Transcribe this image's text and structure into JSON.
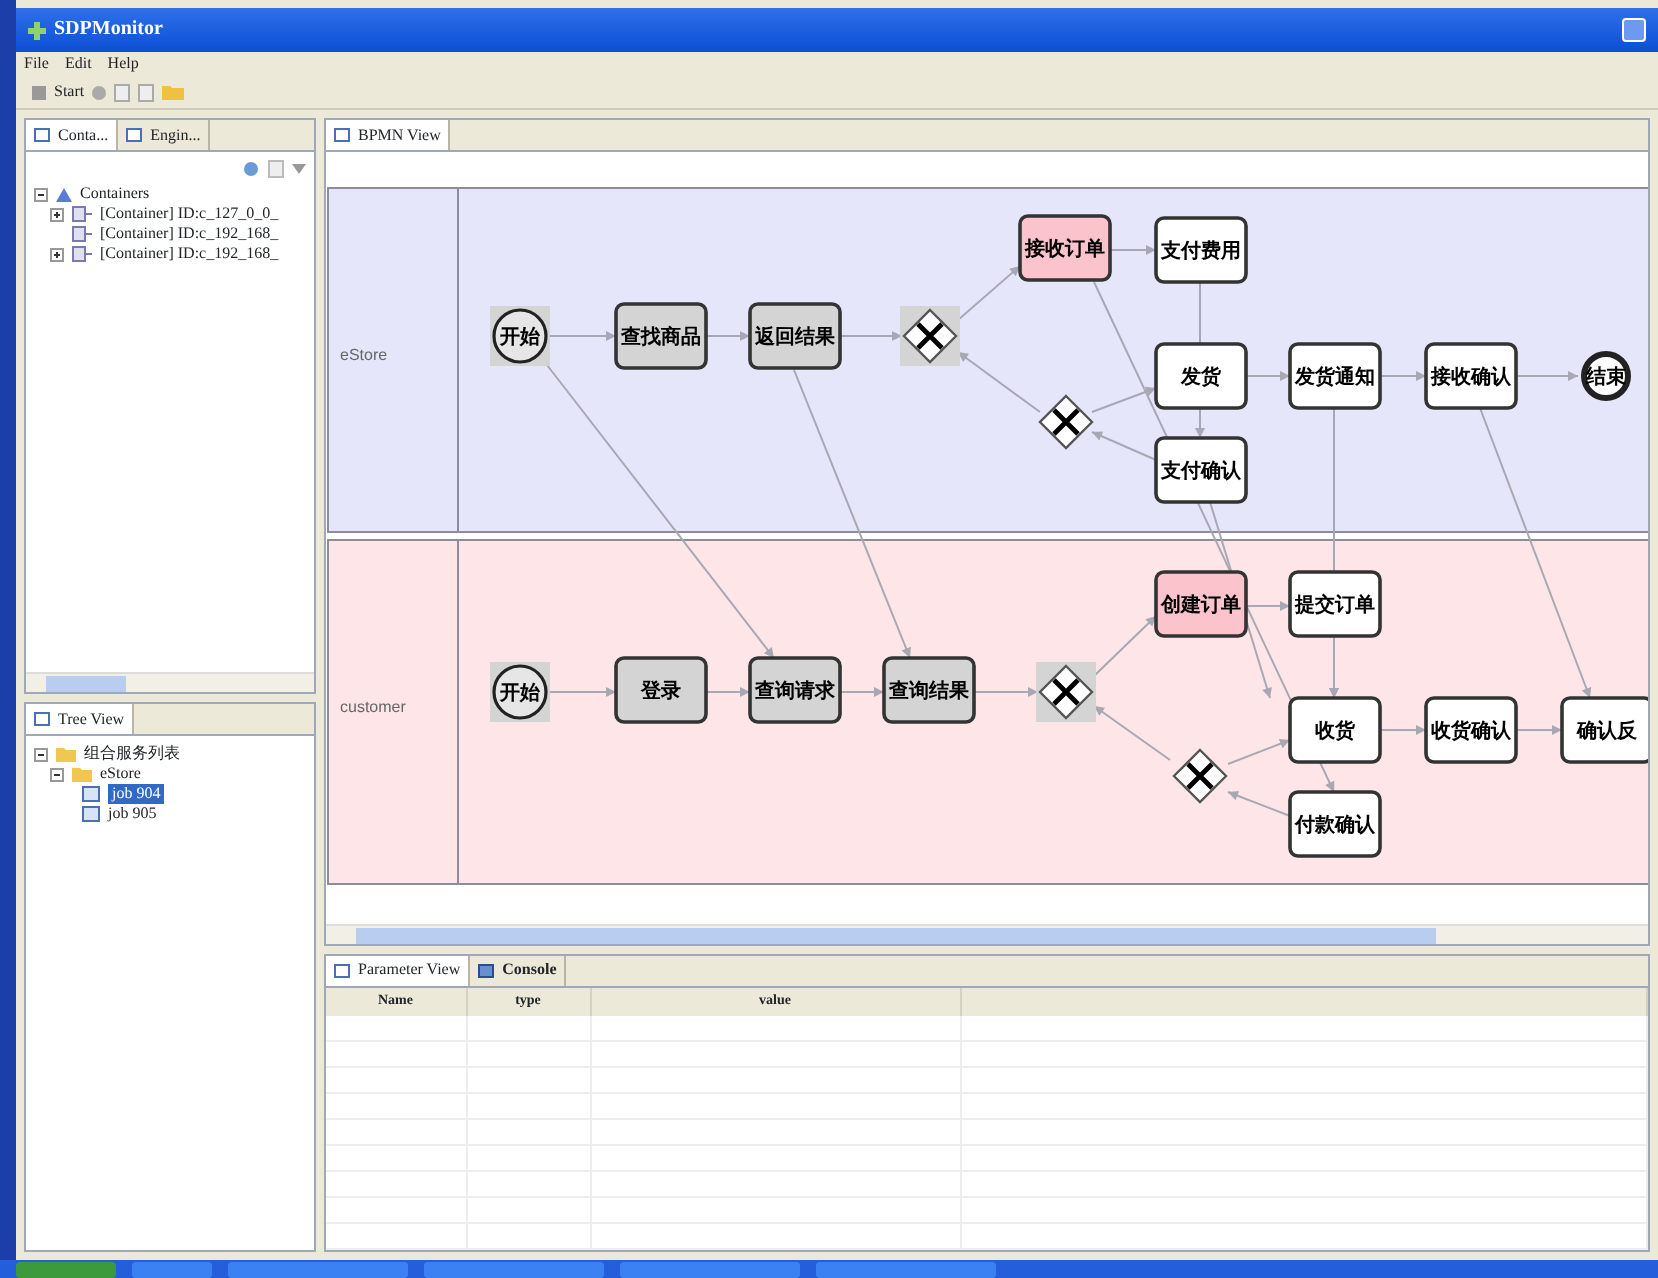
{
  "window": {
    "title": "SDPMonitor"
  },
  "menu": [
    "File",
    "Edit",
    "Help"
  ],
  "toolbar": {
    "start_label": "Start"
  },
  "left_tabs": [
    {
      "label": "Conta...",
      "selected": true
    },
    {
      "label": "Engin...",
      "selected": false
    }
  ],
  "containers_tree": {
    "label": "Containers",
    "expanded": true,
    "children": [
      {
        "label": "[Container] ID:c_127_0_0_",
        "expanded": false
      },
      {
        "label": "[Container] ID:c_192_168_"
      },
      {
        "label": "[Container] ID:c_192_168_",
        "expanded": false
      }
    ]
  },
  "tree_view": {
    "tab": "Tree View",
    "root": {
      "label": "组合服务列表",
      "expanded": true,
      "children": [
        {
          "label": "eStore",
          "expanded": true,
          "children": [
            {
              "label": "job 904",
              "selected": true
            },
            {
              "label": "job 905",
              "selected": false
            }
          ]
        }
      ]
    }
  },
  "bpmn": {
    "tab": "BPMN View",
    "lanes": [
      {
        "name": "eStore",
        "color": "#e6e6fb",
        "nodes": [
          {
            "kind": "start",
            "label": "开始",
            "color": "#d4d4d4"
          },
          {
            "kind": "task",
            "label": "查找商品",
            "color": "#d4d4d4"
          },
          {
            "kind": "task",
            "label": "返回结果",
            "color": "#d4d4d4"
          },
          {
            "kind": "gateway",
            "color": "#d4d4d4"
          },
          {
            "kind": "task",
            "label": "接收订单",
            "color": "#fbc4cc"
          },
          {
            "kind": "task",
            "label": "支付费用",
            "color": "#ffffff"
          },
          {
            "kind": "task",
            "label": "发货",
            "color": "#ffffff"
          },
          {
            "kind": "task",
            "label": "发货通知",
            "color": "#ffffff"
          },
          {
            "kind": "task",
            "label": "接收确认",
            "color": "#ffffff"
          },
          {
            "kind": "end",
            "label": "结束",
            "color": "#ffffff"
          },
          {
            "kind": "gateway",
            "color": "#ffffff"
          },
          {
            "kind": "task",
            "label": "支付确认",
            "color": "#ffffff"
          }
        ]
      },
      {
        "name": "customer",
        "color": "#fde5e8",
        "nodes": [
          {
            "kind": "start",
            "label": "开始",
            "color": "#d4d4d4"
          },
          {
            "kind": "task",
            "label": "登录",
            "color": "#d4d4d4"
          },
          {
            "kind": "task",
            "label": "查询请求",
            "color": "#d4d4d4"
          },
          {
            "kind": "task",
            "label": "查询结果",
            "color": "#d4d4d4"
          },
          {
            "kind": "gateway",
            "color": "#d4d4d4"
          },
          {
            "kind": "task",
            "label": "创建订单",
            "color": "#fbc4cc"
          },
          {
            "kind": "task",
            "label": "提交订单",
            "color": "#ffffff"
          },
          {
            "kind": "task",
            "label": "收货",
            "color": "#ffffff"
          },
          {
            "kind": "task",
            "label": "收货确认",
            "color": "#ffffff"
          },
          {
            "kind": "task",
            "label": "确认反",
            "color": "#ffffff"
          },
          {
            "kind": "gateway",
            "color": "#ffffff"
          },
          {
            "kind": "task",
            "label": "付款确认",
            "color": "#ffffff"
          }
        ]
      }
    ]
  },
  "parameter_view": {
    "tabs": [
      {
        "label": "Parameter View",
        "selected": true
      },
      {
        "label": "Console",
        "selected": false
      }
    ],
    "columns": [
      "Name",
      "type",
      "value"
    ]
  }
}
